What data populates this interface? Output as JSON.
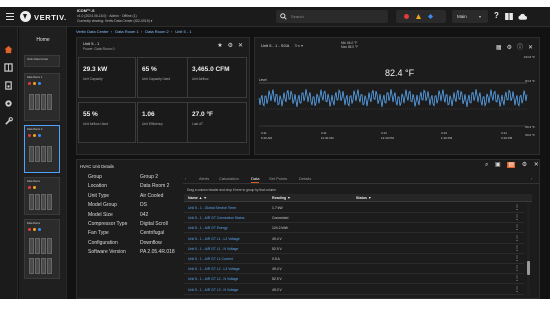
{
  "header": {
    "brand": "VERTIV.",
    "app_name": "ICOM™-S",
    "app_line2": "v1.0 (2024.06.18.0) · Admin · Offline (1)",
    "app_line3": "Currently viewing: Vertiv Data Center (ID2-0015) ▾",
    "search_placeholder": "Search",
    "user": "Main",
    "alarm_colors": {
      "critical": "#e03b3b",
      "warning": "#f2a31c",
      "info": "#3d8bf7"
    }
  },
  "rail": {
    "icons": [
      "home-icon",
      "grid-icon",
      "devices-icon",
      "settings-icon",
      "wrench-icon"
    ]
  },
  "sidebar": {
    "title": "Home",
    "cards": [
      {
        "title": "Vertiv Data Center",
        "selected": false
      },
      {
        "title": "Data Room 1",
        "selected": false
      },
      {
        "title": "Data Room 2",
        "selected": true
      },
      {
        "title": "Data Room",
        "selected": false
      },
      {
        "title": "Data Room",
        "selected": false
      }
    ]
  },
  "breadcrumb": [
    "Vertiv Data Center",
    "Data Room 1",
    "Data Room 2",
    "Unit 5 - 1"
  ],
  "unit_panel": {
    "title": "Unit 5 - 1",
    "subtitle": "Power: Data Room 0",
    "metrics": [
      {
        "value": "29.3 kW",
        "label": "Unit Capacity"
      },
      {
        "value": "65 %",
        "label": "Unit Capacity Used"
      },
      {
        "value": "3,465.0 CFM",
        "label": "Unit Airflow"
      },
      {
        "value": "55 %",
        "label": "Unit Airflow Used"
      },
      {
        "value": "1.06",
        "label": "Unit Efficiency"
      },
      {
        "value": "27.0 °F",
        "label": "Last dT"
      }
    ]
  },
  "trend_panel": {
    "title": "Unit 5 - 1 - SGA",
    "range": "7hr",
    "legend_line1": "Min   66.0 °F",
    "legend_line2": "Max   88.0 °F",
    "current_value": "82.4 °F",
    "series_label": "Level",
    "right_labels": [
      "134.9 °F",
      "84.3 °F",
      "60.3 °F",
      "60.0 °F"
    ],
    "time_labels": [
      {
        "time": "3:11",
        "date": "6:40 AM"
      },
      {
        "time": "3:11",
        "date": "11:40 AM"
      },
      {
        "time": "3:13",
        "date": "12:40 PM"
      },
      {
        "time": "3:13",
        "date": "1:40 PM"
      },
      {
        "time": "3:14",
        "date": "2:40 PM"
      }
    ],
    "accent": "#5aa7f2"
  },
  "details": {
    "title": "HVAC Unit Details",
    "rows": [
      {
        "label": "Group",
        "value": "Group 2"
      },
      {
        "label": "Location",
        "value": "Data Room 2"
      },
      {
        "label": "Unit Type",
        "value": "Air Cooled"
      },
      {
        "label": "Model Group",
        "value": "DS"
      },
      {
        "label": "Model Size",
        "value": "042"
      },
      {
        "label": "Compressor Type",
        "value": "Digital Scroll"
      },
      {
        "label": "Fan Type",
        "value": "Centrifugal"
      },
      {
        "label": "Configuration",
        "value": "Downflow"
      },
      {
        "label": "Software Version",
        "value": "PA 2.05.4R.018"
      }
    ]
  },
  "data_table": {
    "tabs": [
      "Alerts",
      "Calculation",
      "Data",
      "Set Points",
      "Details"
    ],
    "active_tab": "Data",
    "group_hint": "Drag a column header and drop it here to group by that column",
    "columns": [
      "Name",
      "Reading",
      "Status"
    ],
    "rows": [
      {
        "name": "Unit 5 - 1 - Global Service Timer",
        "value": "1.7 kW"
      },
      {
        "name": "Unit 5 - 1 - AIR GT Connection Status",
        "value": "Connected"
      },
      {
        "name": "Unit 5 - 1 - AIR GT Energy",
        "value": "124.2 kWh"
      },
      {
        "name": "Unit 5 - 1 - AIR GT L1 - L2 Voltage",
        "value": "49.4 V"
      },
      {
        "name": "Unit 5 - 1 - AIR GT L1 - N Voltage",
        "value": "52.9 V"
      },
      {
        "name": "Unit 5 - 1 - AIR GT L1 Current",
        "value": "0.5 A"
      },
      {
        "name": "Unit 5 - 1 - AIR GT L2 - L3 Voltage",
        "value": "49.4 V"
      },
      {
        "name": "Unit 5 - 1 - AIR GT L2 - N Voltage",
        "value": "52.9 V"
      },
      {
        "name": "Unit 5 - 1 - AIR GT L3 - N Voltage",
        "value": "49.0 V"
      }
    ]
  }
}
